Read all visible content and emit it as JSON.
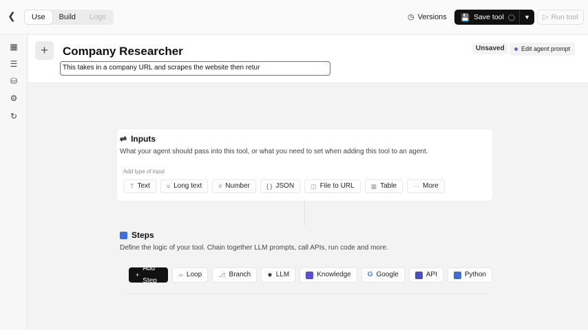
{
  "topbar": {
    "tabs": [
      "Use",
      "Build",
      "Logs"
    ],
    "versions_label": "Versions",
    "save_label": "Save tool",
    "run_label": "Run tool"
  },
  "sidebar": {
    "icons": [
      "panel-icon",
      "list-icon",
      "database-icon",
      "gear-icon",
      "history-icon"
    ]
  },
  "header": {
    "title": "Company Researcher",
    "description": "This takes in a company URL and scrapes the website then retur",
    "status": "Unsaved",
    "edit_prompt_label": "Edit agent prompt"
  },
  "inputs": {
    "title": "Inputs",
    "subtitle": "What your agent should pass into this tool, or what you need to set when adding this tool to an agent.",
    "add_type_label": "Add type of input",
    "types": [
      "Text",
      "Long text",
      "Number",
      "JSON",
      "File to URL",
      "Table",
      "More"
    ]
  },
  "steps": {
    "title": "Steps",
    "subtitle": "Define the logic of your tool. Chain together LLM prompts, call APIs, run code and more.",
    "add_step_label": "Add Step",
    "types": [
      "Loop",
      "Branch",
      "LLM",
      "Knowledge",
      "Google",
      "API",
      "Python"
    ]
  },
  "colors": {
    "accent": "#4a6fd6",
    "primary_button": "#111111"
  }
}
